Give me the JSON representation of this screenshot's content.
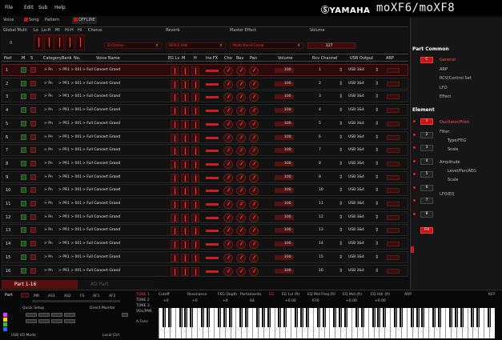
{
  "menubar": {
    "items": [
      "File",
      "Edit",
      "Sub",
      "Help"
    ],
    "brand": "ⓈYAMAHA",
    "model": "moXF6/moXF8"
  },
  "modetabs": {
    "voice": "Voice",
    "song": "Song",
    "pattern": "Pattern",
    "offline": "OFFLINE"
  },
  "common": {
    "headers": [
      "Global Multi",
      "Lo",
      "Lo-H",
      "Mi",
      "Hi-H",
      "Hi",
      "Chorus",
      "Reverb",
      "Master Effect",
      "Volume"
    ],
    "row_label": "0",
    "chorus": "G Chorus",
    "reverb": "REV-X Hall",
    "master_effect": "Multi Band Comp",
    "volume": "127"
  },
  "columns": [
    "Part",
    "M",
    "S",
    "Category",
    "Bank",
    "No.",
    "Voice Name",
    "EG Lv",
    "M",
    "H",
    "Ins FX",
    "Cho",
    "Rev",
    "Pan",
    "Volume",
    "Rcv Channel",
    "USB Output",
    "ARP"
  ],
  "parts": [
    {
      "num": "1",
      "cat": "> Pn",
      "bank": "> PR1 > 001",
      "name": "> Full Concert Grand",
      "vol": "100",
      "rcv": "1",
      "usb": "USB 3&4"
    },
    {
      "num": "2",
      "cat": "> Pn",
      "bank": "> PR1 > 001",
      "name": "> Full Concert Grand",
      "vol": "100",
      "rcv": "2",
      "usb": "USB 3&4"
    },
    {
      "num": "3",
      "cat": "> Pn",
      "bank": "> PR1 > 001",
      "name": "> Full Concert Grand",
      "vol": "100",
      "rcv": "3",
      "usb": "USB 3&4"
    },
    {
      "num": "4",
      "cat": "> Pn",
      "bank": "> PR1 > 001",
      "name": "> Full Concert Grand",
      "vol": "100",
      "rcv": "4",
      "usb": "USB 3&4"
    },
    {
      "num": "5",
      "cat": "> Pn",
      "bank": "> PR1 > 001",
      "name": "> Full Concert Grand",
      "vol": "100",
      "rcv": "5",
      "usb": "USB 3&4"
    },
    {
      "num": "6",
      "cat": "> Pn",
      "bank": "> PR1 > 001",
      "name": "> Full Concert Grand",
      "vol": "100",
      "rcv": "6",
      "usb": "USB 3&4"
    },
    {
      "num": "7",
      "cat": "> Pn",
      "bank": "> PR1 > 001",
      "name": "> Full Concert Grand",
      "vol": "100",
      "rcv": "7",
      "usb": "USB 3&4"
    },
    {
      "num": "8",
      "cat": "> Pn",
      "bank": "> PR1 > 001",
      "name": "> Full Concert Grand",
      "vol": "100",
      "rcv": "8",
      "usb": "USB 3&4"
    },
    {
      "num": "9",
      "cat": "> Pn",
      "bank": "> PR1 > 001",
      "name": "> Full Concert Grand",
      "vol": "100",
      "rcv": "9",
      "usb": "USB 3&4"
    },
    {
      "num": "10",
      "cat": "> Pn",
      "bank": "> PR1 > 001",
      "name": "> Full Concert Grand",
      "vol": "100",
      "rcv": "10",
      "usb": "USB 3&4"
    },
    {
      "num": "11",
      "cat": "> Pn",
      "bank": "> PR1 > 001",
      "name": "> Full Concert Grand",
      "vol": "100",
      "rcv": "11",
      "usb": "USB 3&4"
    },
    {
      "num": "12",
      "cat": "> Pn",
      "bank": "> PR1 > 001",
      "name": "> Full Concert Grand",
      "vol": "100",
      "rcv": "12",
      "usb": "USB 3&4"
    },
    {
      "num": "13",
      "cat": "> Pn",
      "bank": "> PR1 > 001",
      "name": "> Full Concert Grand",
      "vol": "100",
      "rcv": "13",
      "usb": "USB 3&4"
    },
    {
      "num": "14",
      "cat": "> Pn",
      "bank": "> PR1 > 001",
      "name": "> Full Concert Grand",
      "vol": "100",
      "rcv": "14",
      "usb": "USB 3&4"
    },
    {
      "num": "15",
      "cat": "> Pn",
      "bank": "> PR1 > 001",
      "name": "> Full Concert Grand",
      "vol": "100",
      "rcv": "15",
      "usb": "USB 3&4"
    },
    {
      "num": "16",
      "cat": "> Pn",
      "bank": "> PR1 > 001",
      "name": "> Full Concert Grand",
      "vol": "100",
      "rcv": "16",
      "usb": "USB 3&4"
    }
  ],
  "parttabs": {
    "active": "Part 1-16",
    "inactive": "AD Part"
  },
  "rightpanel": {
    "part_common": "Part Common",
    "common_items": [
      "General",
      "ARP",
      "RCV/Control Set",
      "LFO",
      "Effect"
    ],
    "element_title": "Element",
    "element_btns": [
      "1",
      "2",
      "3",
      "4",
      "5",
      "6",
      "7",
      "8"
    ],
    "element_items": [
      "Oscillator/Pitch",
      "Filter",
      "Type/FEG",
      "Scale",
      "Amplitude",
      "Level/Pan/AEG",
      "Scale",
      "LFO/EQ"
    ],
    "fill_label": "Fill"
  },
  "bottom": {
    "part_label": "Part",
    "mod_labels": [
      "MR",
      "AS1",
      "AS2",
      "FS",
      "AF1",
      "AF2"
    ],
    "quick_setup": "Quick Setup",
    "direct_monitor": "Direct Monitor",
    "usb_io_mode": "USB I/O Mode",
    "local_ctrl": "Local Ctrl",
    "tones": [
      "TONE 1",
      "TONE 2",
      "TONE 3",
      "VOL/PAN"
    ],
    "a_func": "A.Func",
    "params": [
      "Cutoff",
      "Resonance",
      "FEG Depth",
      "Portamento",
      "EG",
      "EG Lvl (R)",
      "EQ Mid Freq (R)",
      "EQ Mid (R)",
      "EQ Hdr (R)",
      "ARP"
    ],
    "values": [
      "+0",
      "+0",
      "+0",
      "64",
      "+0.00",
      "670",
      "+0.00",
      "+0.00"
    ],
    "arp_label": "ARP",
    "pre_label": "KEY"
  }
}
